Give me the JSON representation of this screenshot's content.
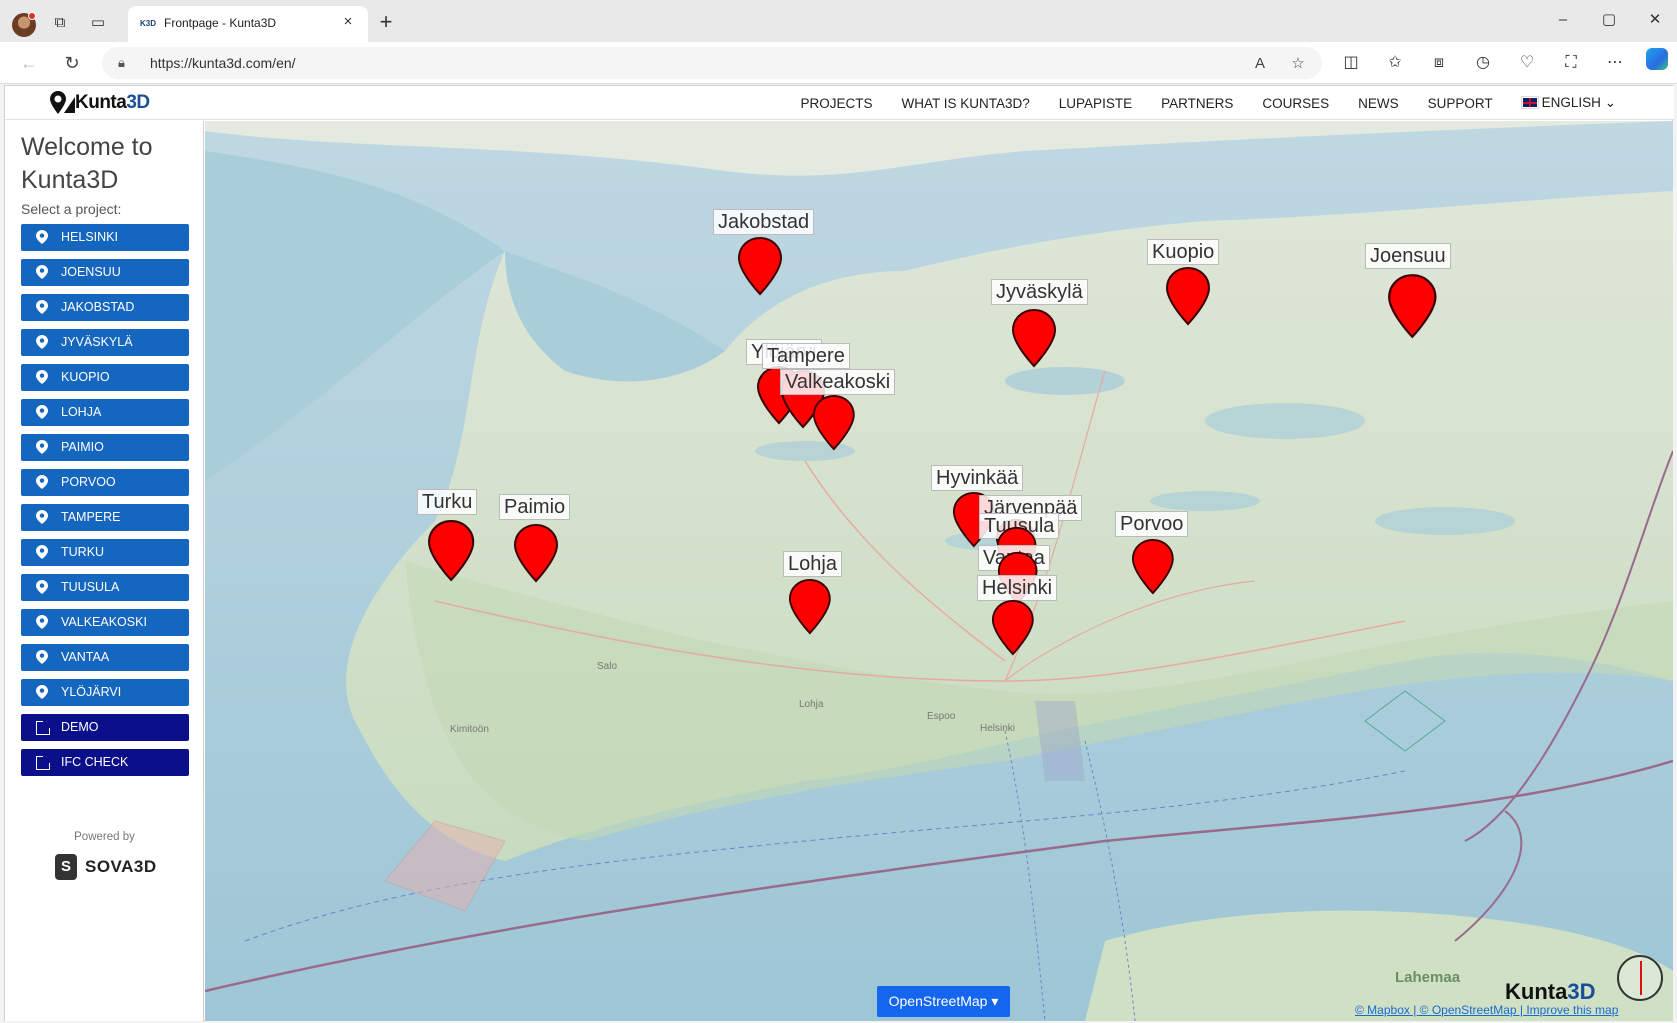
{
  "browser": {
    "tab_title": "Frontpage - Kunta3D",
    "tab_favicon": "K3D",
    "url": "https://kunta3d.com/en/"
  },
  "site": {
    "logo_text_a": "Kunta",
    "logo_text_b": "3D",
    "nav": [
      "PROJECTS",
      "WHAT IS KUNTA3D?",
      "LUPAPISTE",
      "PARTNERS",
      "COURSES",
      "NEWS",
      "SUPPORT"
    ],
    "language": "ENGLISH"
  },
  "sidebar": {
    "welcome": "Welcome to Kunta3D",
    "select_label": "Select a project:",
    "projects": [
      "HELSINKI",
      "JOENSUU",
      "JAKOBSTAD",
      "JYVÄSKYLÄ",
      "KUOPIO",
      "LOHJA",
      "PAIMIO",
      "PORVOO",
      "TAMPERE",
      "TURKU",
      "TUUSULA",
      "VALKEAKOSKI",
      "VANTAA",
      "YLÖJÄRVI"
    ],
    "extras": [
      "DEMO",
      "IFC CHECK"
    ],
    "powered_by": "Powered by",
    "sova_text": "SOVA3D",
    "sova_mark": "S"
  },
  "map": {
    "markers": [
      "Jakobstad",
      "Kuopio",
      "Joensuu",
      "Jyväskylä",
      "Ylöjärvi",
      "Tampere",
      "Valkeakoski",
      "Hyvinkää",
      "Järvenpää",
      "Tuusula",
      "Vantaa",
      "Helsinki",
      "Turku",
      "Paimio",
      "Lohja",
      "Porvoo"
    ],
    "place_labels": [
      "Salo",
      "Kimitoön",
      "Espoo",
      "Lohja",
      "Helsinki",
      "Lahemaa"
    ],
    "layer_button": "OpenStreetMap ▾",
    "logo_a": "Kunta",
    "logo_b": "3D",
    "attribution": "© Mapbox  |  © OpenStreetMap  |  Improve this map"
  },
  "colors": {
    "project_button": "#1566be",
    "extra_button": "#0b0f8a",
    "marker": "#ff0000",
    "layer_button": "#1566ef"
  }
}
